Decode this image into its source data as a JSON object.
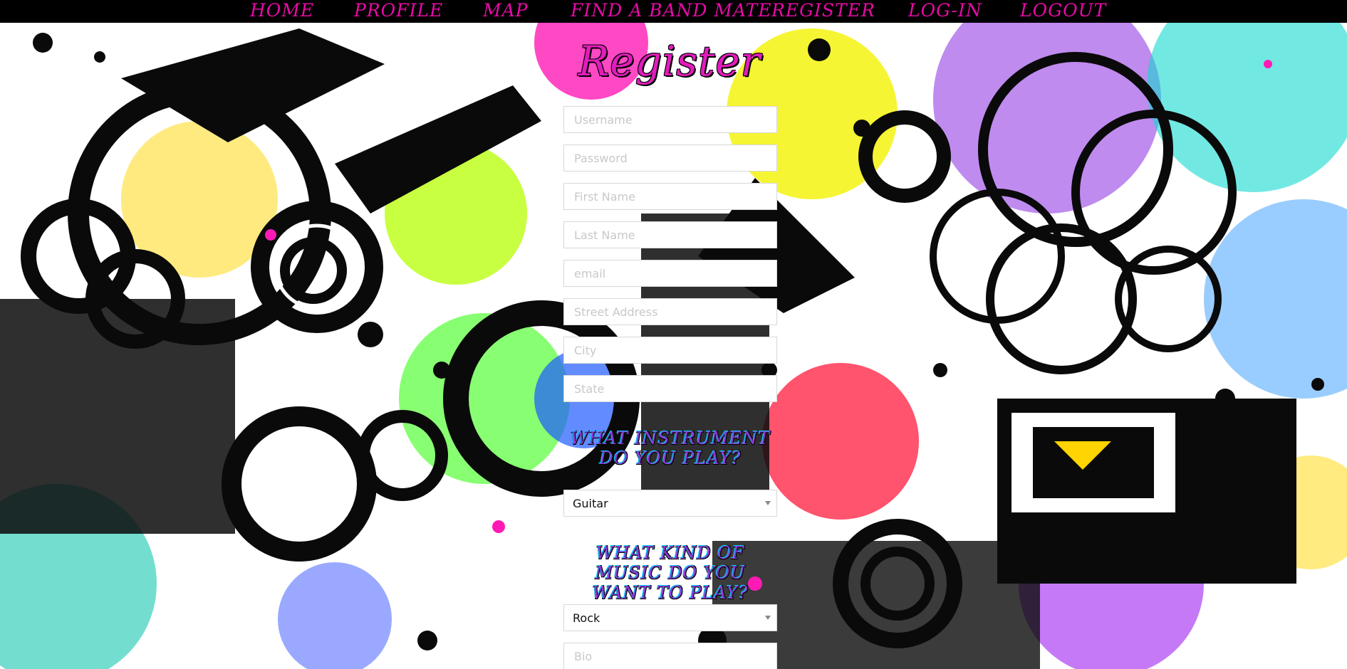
{
  "nav": {
    "items": [
      {
        "label": "HOME"
      },
      {
        "label": "PROFILE"
      },
      {
        "label": "MAP"
      },
      {
        "label": "FIND A BAND MATE"
      },
      {
        "label": "REGISTER"
      },
      {
        "label": "LOG-IN"
      },
      {
        "label": "LOGOUT"
      }
    ]
  },
  "form": {
    "title": "Register",
    "fields": {
      "username": "Username",
      "password": "Password",
      "first_name": "First Name",
      "last_name": "Last Name",
      "email": "email",
      "street": "Street Address",
      "city": "City",
      "state": "State",
      "bio": "Bio"
    },
    "instrument_question": "What instrument do you play?",
    "instrument_value": "Guitar",
    "genre_question": "What kind of music do you want to play?",
    "genre_value": "Rock"
  },
  "colors": {
    "nav_text": "#e60ba5",
    "title": "#e21cbc",
    "question_text": "#8c3bd6"
  }
}
